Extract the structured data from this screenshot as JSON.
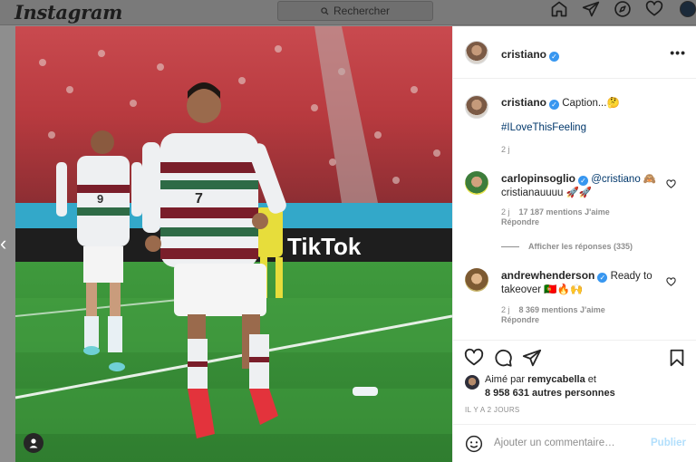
{
  "topbar": {
    "logo": "Instagram",
    "search_placeholder": "Rechercher"
  },
  "post": {
    "author": "cristiano",
    "more_label": "•••",
    "caption": {
      "username": "cristiano",
      "text": "Caption...🤔",
      "hashtag": "#ILoveThisFeeling",
      "age": "2 j"
    },
    "comments": [
      {
        "username": "carlopinsoglio",
        "mention": "@cristiano",
        "text_line1_extra": "🙈",
        "text_line2": "cristianauuuu 🚀🚀",
        "age": "2 j",
        "likes": "17 187 mentions J'aime",
        "reply": "Répondre"
      },
      {
        "username": "andrewhenderson",
        "text_line1": "Ready to",
        "text_line2": "takeover 🇵🇹🔥🙌",
        "age": "2 j",
        "likes": "8 369 mentions J'aime",
        "reply": "Répondre"
      }
    ],
    "view_replies": "Afficher les réponses (335)",
    "liked_by_prefix": "Aimé par",
    "liked_by_user": "remycabella",
    "liked_by_and": "et",
    "liked_by_others": "8 958 631 autres personnes",
    "posted_ago": "IL Y A 2 JOURS",
    "add_comment_placeholder": "Ajouter un commentaire…",
    "publish_label": "Publier"
  },
  "photo": {
    "banner_text": "TikTok",
    "jersey_number_main": "7",
    "jersey_number_back": "9"
  },
  "colors": {
    "verified": "#3897f0",
    "link": "#00376b",
    "publish_disabled": "#b2dffc"
  }
}
